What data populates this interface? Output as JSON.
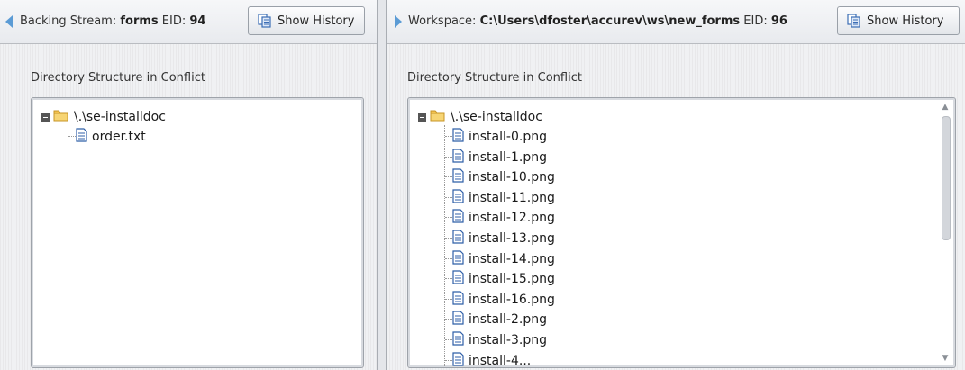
{
  "left": {
    "header_prefix": "Backing Stream:",
    "stream_name": "forms",
    "eid_label": "EID:",
    "eid_value": "94",
    "show_history_label": "Show History",
    "section_label": "Directory Structure in Conflict",
    "root_label": "\\.\\se-installdoc",
    "files": [
      "order.txt"
    ]
  },
  "right": {
    "header_prefix": "Workspace:",
    "workspace_path": "C:\\Users\\dfoster\\accurev\\ws\\new_forms",
    "eid_label": "EID:",
    "eid_value": "96",
    "show_history_label": "Show History",
    "section_label": "Directory Structure in Conflict",
    "root_label": "\\.\\se-installdoc",
    "files": [
      "install-0.png",
      "install-1.png",
      "install-10.png",
      "install-11.png",
      "install-12.png",
      "install-13.png",
      "install-14.png",
      "install-15.png",
      "install-16.png",
      "install-2.png",
      "install-3.png",
      "install-4..."
    ]
  },
  "colors": {
    "accent": "#5b9bd5",
    "folder": "#f2c14e",
    "file_icon": "#2f5fa8"
  },
  "icons": {
    "collapse_left": "triangle-left-icon",
    "expand_right": "triangle-right-icon",
    "history": "copy-pages-icon",
    "folder": "folder-icon",
    "file": "document-icon",
    "expander": "minus-box-icon"
  }
}
